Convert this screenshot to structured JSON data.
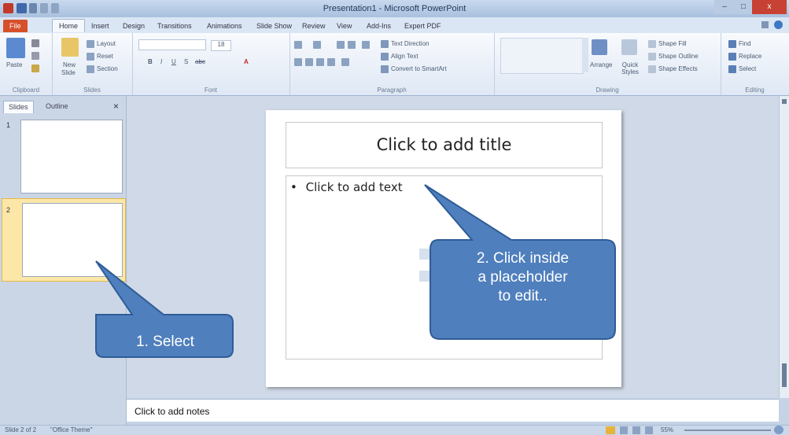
{
  "window": {
    "title": "Presentation1 - Microsoft PowerPoint",
    "min": "–",
    "max": "□",
    "close": "x"
  },
  "tabs": [
    "File",
    "Home",
    "Insert",
    "Design",
    "Transitions",
    "Animations",
    "Slide Show",
    "Review",
    "View",
    "Add-Ins",
    "Expert PDF"
  ],
  "ribbon": {
    "clipboard": {
      "paste": "Paste",
      "label": "Clipboard"
    },
    "slides": {
      "new_slide": "New",
      "new_slide2": "Slide",
      "layout": "Layout",
      "reset": "Reset",
      "section": "Section",
      "label": "Slides"
    },
    "font": {
      "label": "Font",
      "size": "18"
    },
    "paragraph": {
      "label": "Paragraph",
      "text_direction": "Text Direction",
      "align_text": "Align Text",
      "convert_smartart": "Convert to SmartArt"
    },
    "drawing": {
      "label": "Drawing",
      "arrange": "Arrange",
      "quick_styles": "Quick Styles",
      "shape_fill": "Shape Fill",
      "shape_outline": "Shape Outline",
      "shape_effects": "Shape Effects"
    },
    "editing": {
      "label": "Editing",
      "find": "Find",
      "replace": "Replace",
      "select": "Select"
    }
  },
  "panel": {
    "tab_slides": "Slides",
    "tab_outline": "Outline",
    "close": "×",
    "thumbnails": [
      "1",
      "2"
    ]
  },
  "slide": {
    "title_placeholder": "Click to add title",
    "body_placeholder": "Click to add text",
    "bullet": "•"
  },
  "notes": {
    "placeholder": "Click to add notes"
  },
  "status": {
    "slide_info": "Slide 2 of 2",
    "theme": "\"Office Theme\"",
    "zoom": "55%"
  },
  "callouts": {
    "one": "1. Select",
    "two_line1": "2. Click inside",
    "two_line2": "a placeholder",
    "two_line3": "to edit.."
  },
  "colors": {
    "callout_fill": "#4f7fbd",
    "callout_border": "#2e5d97",
    "file_tab": "#d6502a"
  }
}
